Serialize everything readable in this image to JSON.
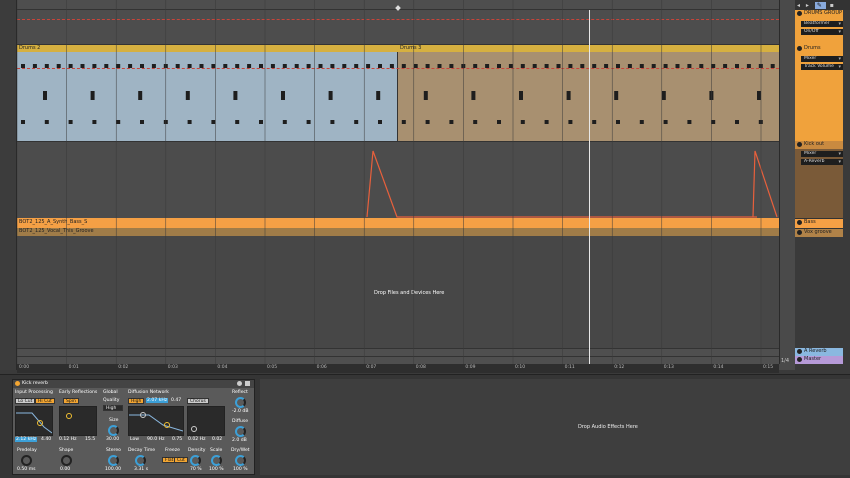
{
  "clips": {
    "drums_2": "Drums 2",
    "drums_3": "Drums 3",
    "synth_bass": "BOT2_125_A_Synth_Bass_S",
    "vocal": "BOT2_125_Vocal_This_Groove"
  },
  "drop_zone": "Drop Files and Devices Here",
  "drop_audio": "Drop Audio Effects Here",
  "tracks": {
    "drums_group": "DRUMS GROUP",
    "drums_group_device": "Beatformer",
    "drums_group_param": "On/Off",
    "drums": "Drums",
    "drums_device": "Mixer",
    "drums_param": "Track Volume",
    "kick_out": "Kick out",
    "kick_device": "Mixer",
    "kick_param": "A-Reverb",
    "bass": "Bass",
    "vox_groove": "Vox groove",
    "a_reverb": "A Reverb",
    "master": "Master"
  },
  "ruler": [
    "0:00",
    "0:01",
    "0:02",
    "0:03",
    "0:04",
    "0:05",
    "0:06",
    "0:07",
    "0:08",
    "0:09",
    "0:10",
    "0:11",
    "0:12",
    "0:13",
    "0:14",
    "0:15"
  ],
  "ruler_zoom": "1/4",
  "device": {
    "title": "Kick reverb",
    "input_processing": "Input Processing",
    "lo_cut": "Lo Cut",
    "hi_cut": "Hi Cut",
    "in_freq_low": "2.12 kHz",
    "in_freq_high": "4.40",
    "early_reflections": "Early Reflections",
    "spin": "Spin",
    "er_amount": "0.12 Hz",
    "er_shape": "15.5",
    "global": "Global",
    "quality": "Quality",
    "quality_value": "High",
    "size": "Size",
    "size_value": "30.00",
    "diffusion_network": "Diffusion Network",
    "high": "High",
    "dn_freq": "2.07 kHz",
    "dn_level": "0.47",
    "chorus": "Chorus",
    "low": "Low",
    "low_freq": "90.0 Hz",
    "low_level": "0.75",
    "chorus_rate": "0.02 Hz",
    "chorus_amount": "0.02",
    "reflect": "Reflect",
    "reflect_value": "-2.0 dB",
    "diffuse": "Diffuse",
    "diffuse_value": "2.0 dB",
    "predelay": "Predelay",
    "predelay_value": "0.50 ms",
    "shape": "Shape",
    "shape_value": "0.00",
    "stereo": "Stereo",
    "stereo_value": "100.00",
    "decay_time": "Decay Time",
    "decay_value": "3.31 s",
    "freeze": "Freeze",
    "flat": "Flat",
    "cut": "Cut",
    "density": "Density",
    "density_value": "70 %",
    "scale": "Scale",
    "scale_value": "100 %",
    "dry_wet": "Dry/Wet",
    "dry_wet_value": "100 %"
  },
  "colors": {
    "drum_clip_a": "#9fb4c4",
    "drum_clip_b": "#a89070",
    "clip_header": "#d6b040",
    "group_orange": "#f0a23c",
    "bass_orange": "#f5a045",
    "envelope": "#e8603c",
    "reverb_blue": "#8ab8e0",
    "master_purple": "#b69ad8"
  }
}
